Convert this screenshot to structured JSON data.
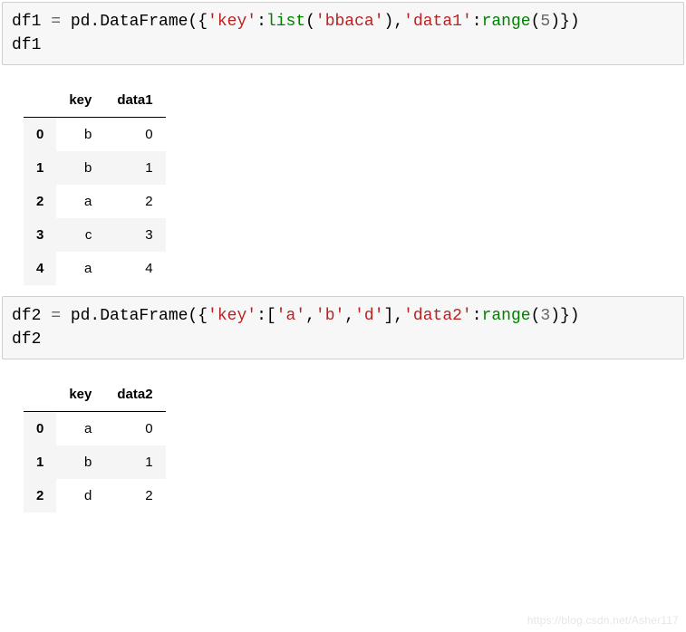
{
  "cell1": {
    "tokens": {
      "var1": "df1",
      "assign": " = ",
      "pd_call": "pd.DataFrame({",
      "str_key": "'key'",
      "colon1": ":",
      "list_fn": "list",
      "lparen1": "(",
      "str_bbaca": "'bbaca'",
      "rparen1": "),",
      "str_data1": "'data1'",
      "colon2": ":",
      "range_fn": "range",
      "lparen2": "(",
      "num5": "5",
      "rparen2": ")})",
      "line2": "df1"
    }
  },
  "table1": {
    "columns": [
      "key",
      "data1"
    ],
    "rows": [
      {
        "idx": "0",
        "c0": "b",
        "c1": "0"
      },
      {
        "idx": "1",
        "c0": "b",
        "c1": "1"
      },
      {
        "idx": "2",
        "c0": "a",
        "c1": "2"
      },
      {
        "idx": "3",
        "c0": "c",
        "c1": "3"
      },
      {
        "idx": "4",
        "c0": "a",
        "c1": "4"
      }
    ]
  },
  "cell2": {
    "tokens": {
      "var2": "df2",
      "assign": " = ",
      "pd_call": "pd.DataFrame({",
      "str_key": "'key'",
      "colon1": ":[",
      "str_a": "'a'",
      "comma1": ",",
      "str_b": "'b'",
      "comma2": ",",
      "str_d": "'d'",
      "close_list": "],",
      "str_data2": "'data2'",
      "colon2": ":",
      "range_fn": "range",
      "lparen2": "(",
      "num3": "3",
      "rparen2": ")})",
      "line2": "df2"
    }
  },
  "table2": {
    "columns": [
      "key",
      "data2"
    ],
    "rows": [
      {
        "idx": "0",
        "c0": "a",
        "c1": "0"
      },
      {
        "idx": "1",
        "c0": "b",
        "c1": "1"
      },
      {
        "idx": "2",
        "c0": "d",
        "c1": "2"
      }
    ]
  },
  "watermark": "https://blog.csdn.net/Asher117"
}
